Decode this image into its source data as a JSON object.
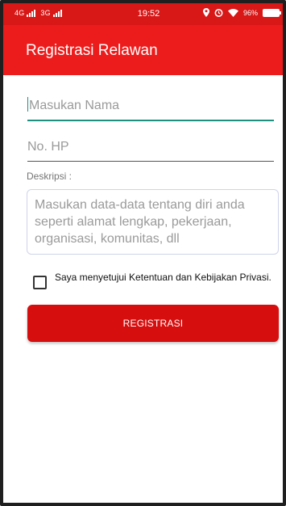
{
  "status_bar": {
    "network_1": "4G",
    "network_2": "3G",
    "time": "19:52",
    "battery": "96%",
    "icons": [
      "signal-icon",
      "location-icon",
      "alarm-icon",
      "wifi-icon",
      "battery-icon"
    ]
  },
  "app_bar": {
    "title": "Registrasi Relawan",
    "color": "#ed1c1c"
  },
  "form": {
    "name_placeholder": "Masukan Nama",
    "phone_placeholder": "No. HP",
    "description_label": "Deskripsi :",
    "description_placeholder": "Masukan data-data tentang diri anda seperti alamat lengkap, pekerjaan, organisasi, komunitas, dll",
    "agreement_text": "Saya menyetujui Ketentuan dan Kebijakan Privasi.",
    "agreement_checked": false,
    "submit_label": "REGISTRASI"
  },
  "colors": {
    "accent": "#1f8f7f",
    "button": "#d70e0e",
    "status_bar": "#d81717"
  }
}
